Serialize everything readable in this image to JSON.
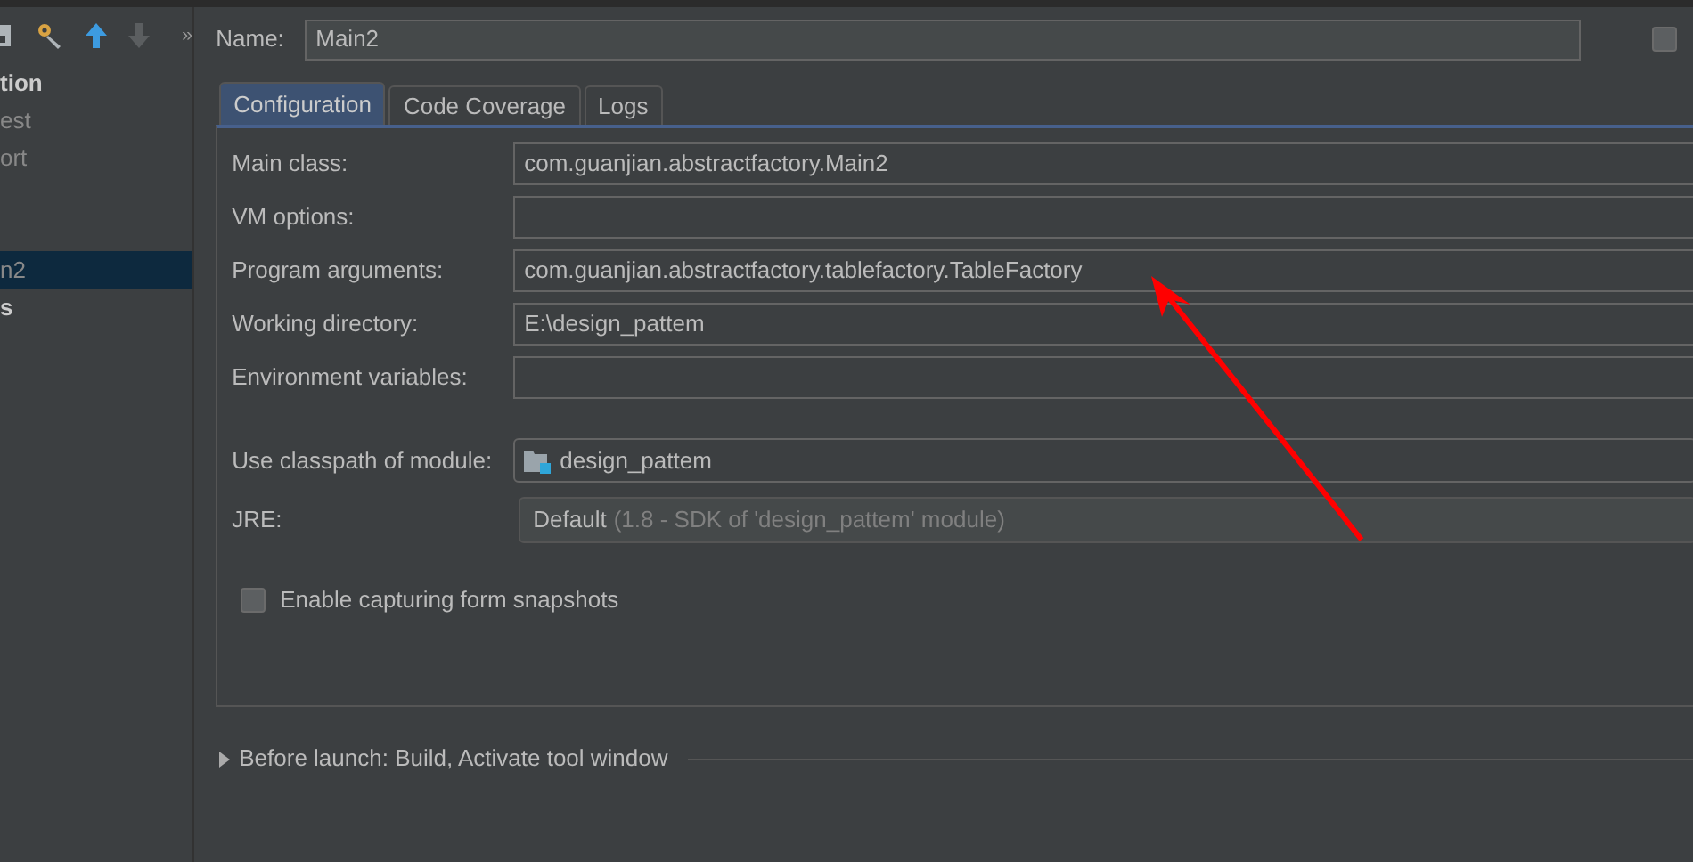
{
  "toolbar": {
    "overflow": "»"
  },
  "sidebar": {
    "items": [
      {
        "label": "tion",
        "bold": true,
        "selected": false
      },
      {
        "label": "est",
        "bold": false,
        "selected": false
      },
      {
        "label": "ort",
        "bold": false,
        "selected": false
      },
      {
        "label": "n2",
        "bold": false,
        "selected": true,
        "gap_before": true
      },
      {
        "label": "s",
        "bold": true,
        "selected": false
      }
    ]
  },
  "name_field": {
    "label": "Name:",
    "value": "Main2"
  },
  "share_checkbox": {
    "checked": false
  },
  "tabs": [
    {
      "label": "Configuration",
      "selected": true
    },
    {
      "label": "Code Coverage",
      "selected": false
    },
    {
      "label": "Logs",
      "selected": false
    }
  ],
  "fields": [
    {
      "kind": "text",
      "label": "Main class:",
      "value": "com.guanjian.abstractfactory.Main2"
    },
    {
      "kind": "text",
      "label": "VM options:"
    },
    {
      "kind": "text",
      "label": "Program arguments:",
      "value": "com.guanjian.abstractfactory.tablefactory.TableFactory"
    },
    {
      "kind": "text",
      "label": "Working directory:",
      "value": "E:\\design_pattem"
    },
    {
      "kind": "text",
      "label": "Environment variables:"
    },
    {
      "kind": "module",
      "label": "Use classpath of module:",
      "value": "design_pattem"
    },
    {
      "kind": "jre",
      "label": "JRE:",
      "value": "Default",
      "hint": "(1.8 - SDK of 'design_pattem' module)"
    }
  ],
  "snapshots_checkbox": {
    "label": "Enable capturing form snapshots",
    "checked": false
  },
  "before_launch": {
    "label": "Before launch: Build, Activate tool window",
    "expanded": false
  }
}
